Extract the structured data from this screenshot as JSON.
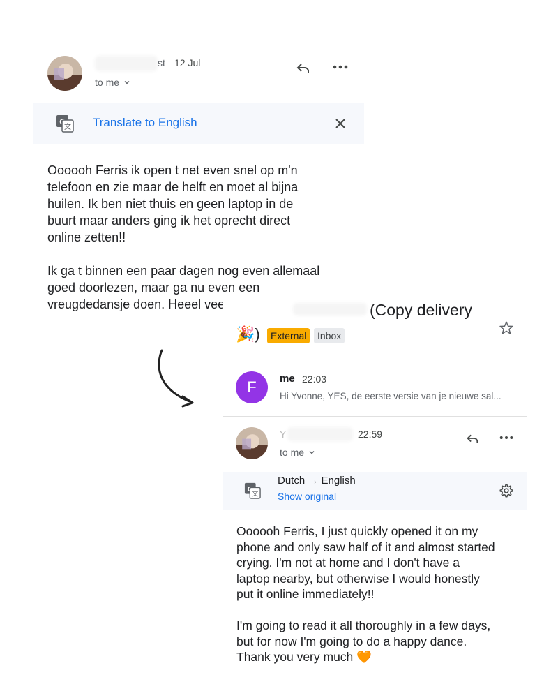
{
  "original_email": {
    "sender_visible": "st",
    "date": "12 Jul",
    "recipient": "to me",
    "translate_bar": {
      "action_label": "Translate to English"
    },
    "body": "Oooooh Ferris ik open t net even snel op m'n\ntelefoon en zie maar de helft en moet al bijna\nhuilen. Ik ben niet thuis en geen laptop in de\nbuurt maar anders ging ik het oprecht direct\nonline zetten!!\n\nIk ga t binnen een paar dagen nog even allemaal\ngoed doorlezen, maar ga nu even een\nvreugdedansje doen. Heeel veel dank 🧡"
  },
  "translated_thread": {
    "subject": "(Copy delivery",
    "subject_emoji": "🎉)",
    "labels": [
      "External",
      "Inbox"
    ],
    "collapsed_message": {
      "avatar_letter": "F",
      "sender": "me",
      "time": "22:03",
      "snippet": "Hi Yvonne, YES, de eerste versie van je nieuwe sal..."
    },
    "open_message": {
      "sender_visible": "Y",
      "time": "22:59",
      "recipient": "to me",
      "translation_bar": {
        "languages": "Dutch → English",
        "show_original_label": "Show original"
      },
      "body": "Oooooh Ferris, I just quickly opened it on my\nphone and only saw half of it and almost started\ncrying. I'm not at home and I don't have a\nlaptop nearby, but otherwise I would honestly\nput it online immediately!!\n\nI'm going to read it all thoroughly in a few days,\nbut for now I'm going to do a happy dance.\nThank you very much 🧡"
    }
  },
  "icons": [
    "reply-icon",
    "more-icon",
    "translate-icon",
    "close-icon",
    "star-icon",
    "settings-icon",
    "chevron-down-icon",
    "arrow-annotation"
  ],
  "colors": {
    "link": "#1a73e8",
    "external_label": "#f9ab00",
    "avatar_me": "#9334e6",
    "bar_bg": "#f6f8fc"
  }
}
